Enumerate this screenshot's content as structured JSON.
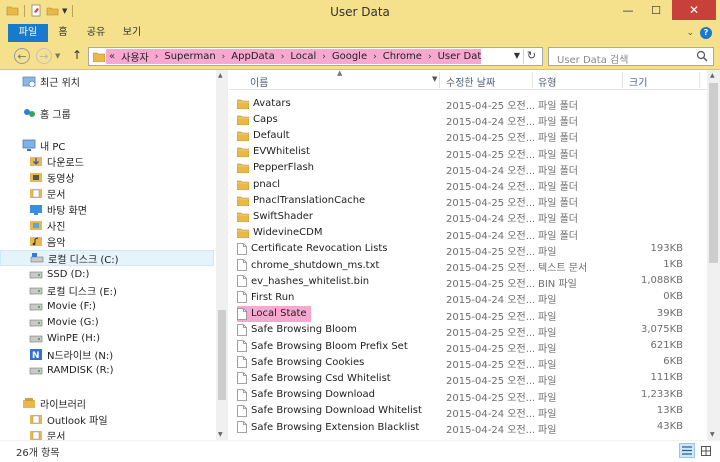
{
  "window": {
    "title": "User Data"
  },
  "ribbon": {
    "tabs": [
      "파일",
      "홈",
      "공유",
      "보기"
    ]
  },
  "address": {
    "lead": "«",
    "crumbs": [
      "사용자",
      "Superman",
      "AppData",
      "Local",
      "Google",
      "Chrome",
      "User Data"
    ],
    "separator": "›"
  },
  "search": {
    "placeholder": "User Data 검색"
  },
  "nav": {
    "items": [
      {
        "label": "최근 위치",
        "icon": "recent-places-icon",
        "level": 1
      },
      {
        "label": "홈 그룹",
        "icon": "homegroup-icon",
        "level": 1
      },
      {
        "label": "내 PC",
        "icon": "this-pc-icon",
        "level": 1
      },
      {
        "label": "다운로드",
        "icon": "downloads-icon",
        "level": 2
      },
      {
        "label": "동영상",
        "icon": "videos-icon",
        "level": 2
      },
      {
        "label": "문서",
        "icon": "documents-icon",
        "level": 2
      },
      {
        "label": "바탕 화면",
        "icon": "desktop-icon",
        "level": 2
      },
      {
        "label": "사진",
        "icon": "pictures-icon",
        "level": 2
      },
      {
        "label": "음악",
        "icon": "music-icon",
        "level": 2
      },
      {
        "label": "로컬 디스크 (C:)",
        "icon": "system-drive-icon",
        "level": 2,
        "selected": true
      },
      {
        "label": "SSD (D:)",
        "icon": "drive-icon",
        "level": 2
      },
      {
        "label": "로컬 디스크 (E:)",
        "icon": "drive-icon",
        "level": 2
      },
      {
        "label": "Movie (F:)",
        "icon": "drive-icon",
        "level": 2
      },
      {
        "label": "Movie (G:)",
        "icon": "drive-icon",
        "level": 2
      },
      {
        "label": "WinPE (H:)",
        "icon": "drive-icon",
        "level": 2
      },
      {
        "label": "N드라이브 (N:)",
        "icon": "ndrive-icon",
        "level": 2
      },
      {
        "label": "RAMDISK (R:)",
        "icon": "drive-icon",
        "level": 2
      },
      {
        "label": "라이브러리",
        "icon": "libraries-icon",
        "level": 1
      },
      {
        "label": "Outlook 파일",
        "icon": "documents-icon",
        "level": 2
      },
      {
        "label": "문서",
        "icon": "documents-icon",
        "level": 2
      }
    ]
  },
  "columns": {
    "name": "이름",
    "date": "수정한 날짜",
    "type": "유형",
    "size": "크기"
  },
  "files": [
    {
      "name": "Avatars",
      "date": "2015-04-25 오전...",
      "type": "파일 폴더",
      "size": "",
      "kind": "folder"
    },
    {
      "name": "Caps",
      "date": "2015-04-24 오전...",
      "type": "파일 폴더",
      "size": "",
      "kind": "folder"
    },
    {
      "name": "Default",
      "date": "2015-04-25 오전...",
      "type": "파일 폴더",
      "size": "",
      "kind": "folder"
    },
    {
      "name": "EVWhitelist",
      "date": "2015-04-25 오전...",
      "type": "파일 폴더",
      "size": "",
      "kind": "folder"
    },
    {
      "name": "PepperFlash",
      "date": "2015-04-24 오전...",
      "type": "파일 폴더",
      "size": "",
      "kind": "folder"
    },
    {
      "name": "pnacl",
      "date": "2015-04-24 오전...",
      "type": "파일 폴더",
      "size": "",
      "kind": "folder"
    },
    {
      "name": "PnaclTranslationCache",
      "date": "2015-04-25 오전...",
      "type": "파일 폴더",
      "size": "",
      "kind": "folder"
    },
    {
      "name": "SwiftShader",
      "date": "2015-04-24 오전...",
      "type": "파일 폴더",
      "size": "",
      "kind": "folder"
    },
    {
      "name": "WidevineCDM",
      "date": "2015-04-24 오전...",
      "type": "파일 폴더",
      "size": "",
      "kind": "folder"
    },
    {
      "name": "Certificate Revocation Lists",
      "date": "2015-04-25 오전...",
      "type": "파일",
      "size": "193KB",
      "kind": "file"
    },
    {
      "name": "chrome_shutdown_ms.txt",
      "date": "2015-04-25 오전...",
      "type": "텍스트 문서",
      "size": "1KB",
      "kind": "file"
    },
    {
      "name": "ev_hashes_whitelist.bin",
      "date": "2015-04-25 오전...",
      "type": "BIN 파일",
      "size": "1,088KB",
      "kind": "file"
    },
    {
      "name": "First Run",
      "date": "2015-04-24 오전...",
      "type": "파일",
      "size": "0KB",
      "kind": "file"
    },
    {
      "name": "Local State",
      "date": "2015-04-25 오전...",
      "type": "파일",
      "size": "39KB",
      "kind": "file",
      "highlighted": true
    },
    {
      "name": "Safe Browsing Bloom",
      "date": "2015-04-25 오전...",
      "type": "파일",
      "size": "3,075KB",
      "kind": "file"
    },
    {
      "name": "Safe Browsing Bloom Prefix Set",
      "date": "2015-04-25 오전...",
      "type": "파일",
      "size": "621KB",
      "kind": "file"
    },
    {
      "name": "Safe Browsing Cookies",
      "date": "2015-04-25 오전...",
      "type": "파일",
      "size": "6KB",
      "kind": "file"
    },
    {
      "name": "Safe Browsing Csd Whitelist",
      "date": "2015-04-25 오전...",
      "type": "파일",
      "size": "111KB",
      "kind": "file"
    },
    {
      "name": "Safe Browsing Download",
      "date": "2015-04-25 오전...",
      "type": "파일",
      "size": "1,233KB",
      "kind": "file"
    },
    {
      "name": "Safe Browsing Download Whitelist",
      "date": "2015-04-24 오전...",
      "type": "파일",
      "size": "13KB",
      "kind": "file"
    },
    {
      "name": "Safe Browsing Extension Blacklist",
      "date": "2015-04-24 오전...",
      "type": "파일",
      "size": "43KB",
      "kind": "file"
    }
  ],
  "status": {
    "count": "26개 항목"
  },
  "colors": {
    "titlebar": "#f5e08c",
    "file_tab": "#1979ca",
    "highlight": "#f7a8d0",
    "close": "#c7403a"
  }
}
